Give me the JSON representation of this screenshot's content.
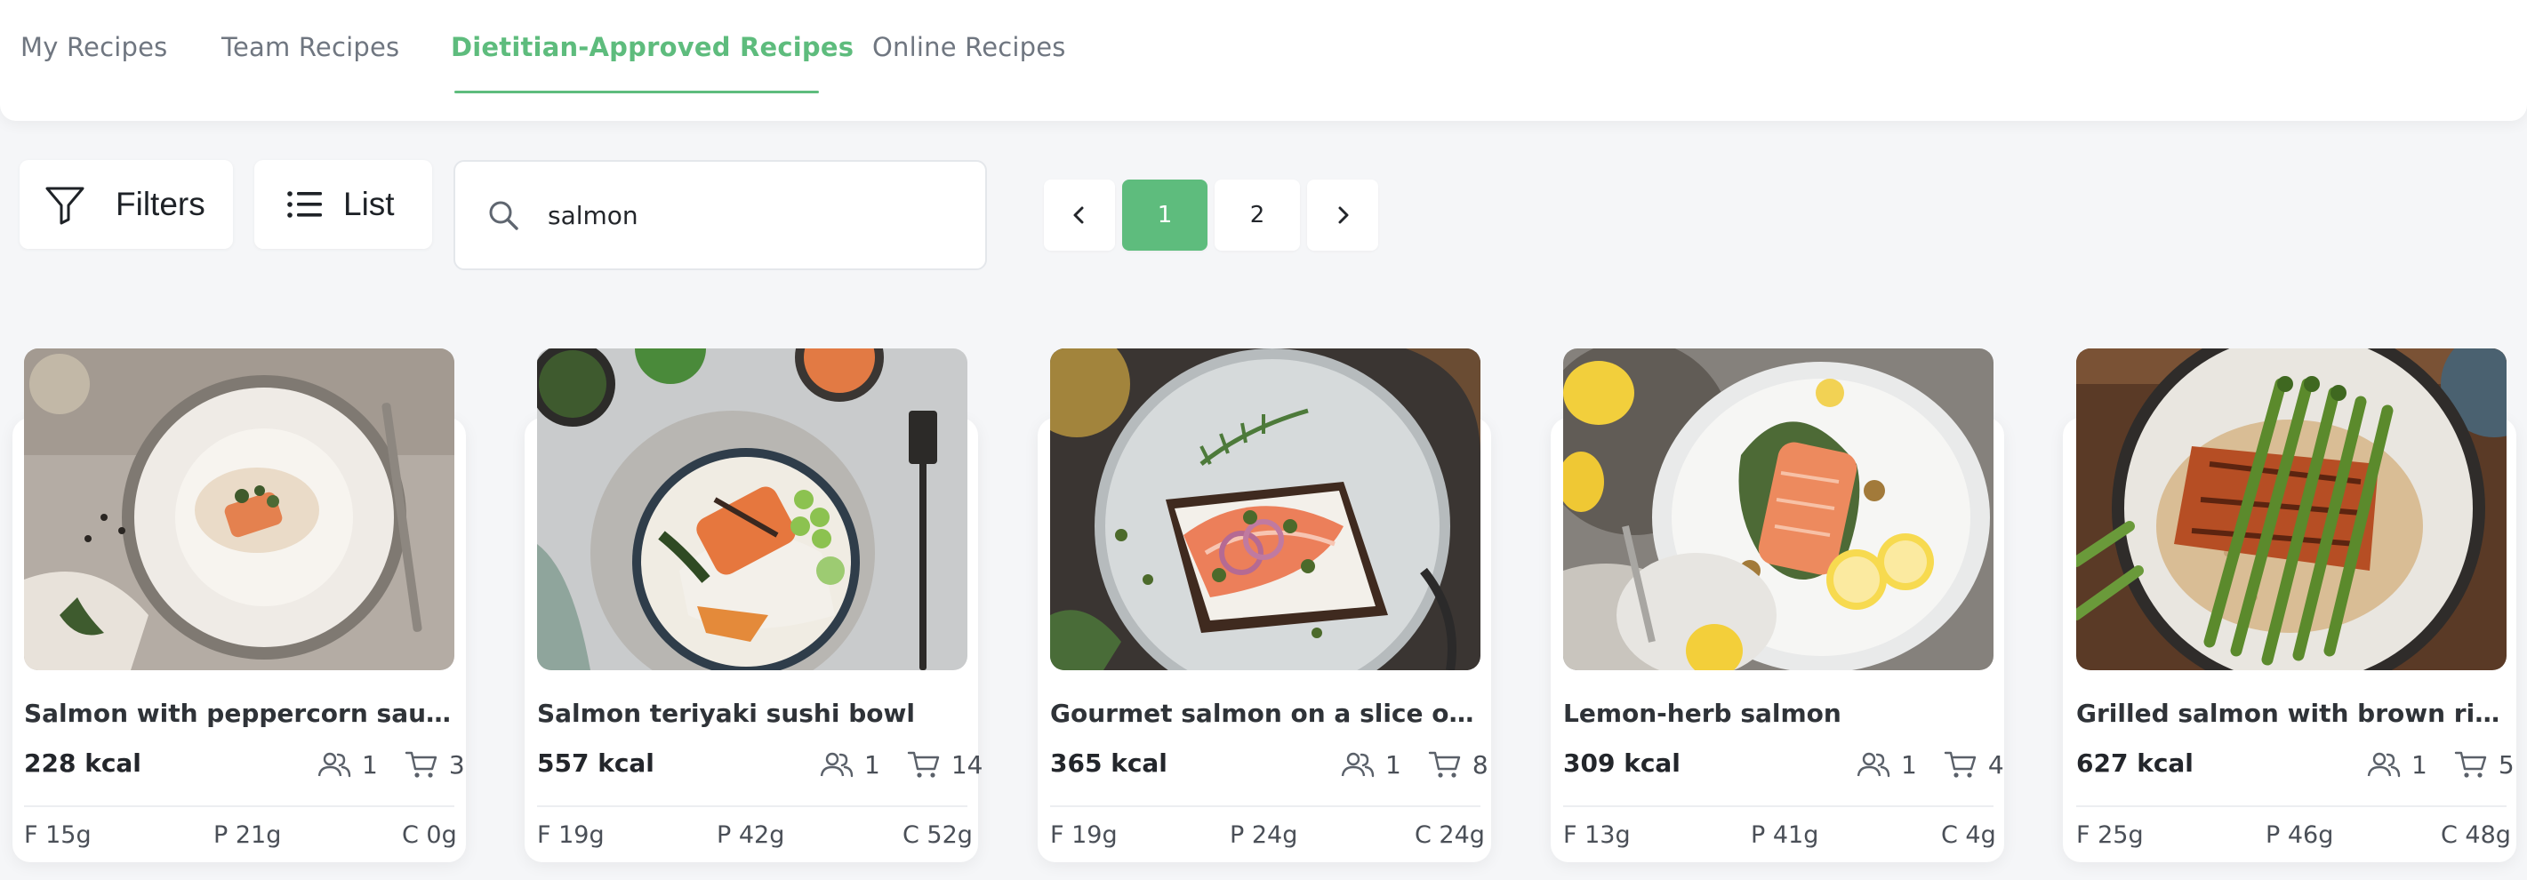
{
  "tabs": [
    {
      "label": "My Recipes",
      "active": false
    },
    {
      "label": "Team Recipes",
      "active": false
    },
    {
      "label": "Dietitian-Approved Recipes",
      "active": true
    },
    {
      "label": "Online Recipes",
      "active": false
    }
  ],
  "toolbar": {
    "filters_label": "Filters",
    "list_label": "List",
    "search_value": "salmon"
  },
  "pagination": {
    "pages": [
      "1",
      "2"
    ],
    "current": "1"
  },
  "colors": {
    "accent": "#5ebc7d",
    "background": "#f5f6f8",
    "card": "#ffffff"
  },
  "recipes": [
    {
      "title": "Salmon with peppercorn sauce",
      "kcal": "228 kcal",
      "servings": "1",
      "cart": "3",
      "fat": "F 15g",
      "protein": "P 21g",
      "carbs": "C 0g",
      "image": "salmon-peppercorn-plate"
    },
    {
      "title": "Salmon teriyaki sushi bowl",
      "kcal": "557 kcal",
      "servings": "1",
      "cart": "14",
      "fat": "F 19g",
      "protein": "P 42g",
      "carbs": "C 52g",
      "image": "salmon-sushi-bowl"
    },
    {
      "title": "Gourmet salmon on a slice of so…",
      "kcal": "365 kcal",
      "servings": "1",
      "cart": "8",
      "fat": "F 19g",
      "protein": "P 24g",
      "carbs": "C 24g",
      "image": "salmon-toast"
    },
    {
      "title": "Lemon-herb salmon",
      "kcal": "309 kcal",
      "servings": "1",
      "cart": "4",
      "fat": "F 13g",
      "protein": "P 41g",
      "carbs": "C 4g",
      "image": "lemon-herb-salmon"
    },
    {
      "title": "Grilled salmon with brown rice a…",
      "kcal": "627 kcal",
      "servings": "1",
      "cart": "5",
      "fat": "F 25g",
      "protein": "P 46g",
      "carbs": "C 48g",
      "image": "grilled-salmon-rice-asparagus"
    }
  ]
}
